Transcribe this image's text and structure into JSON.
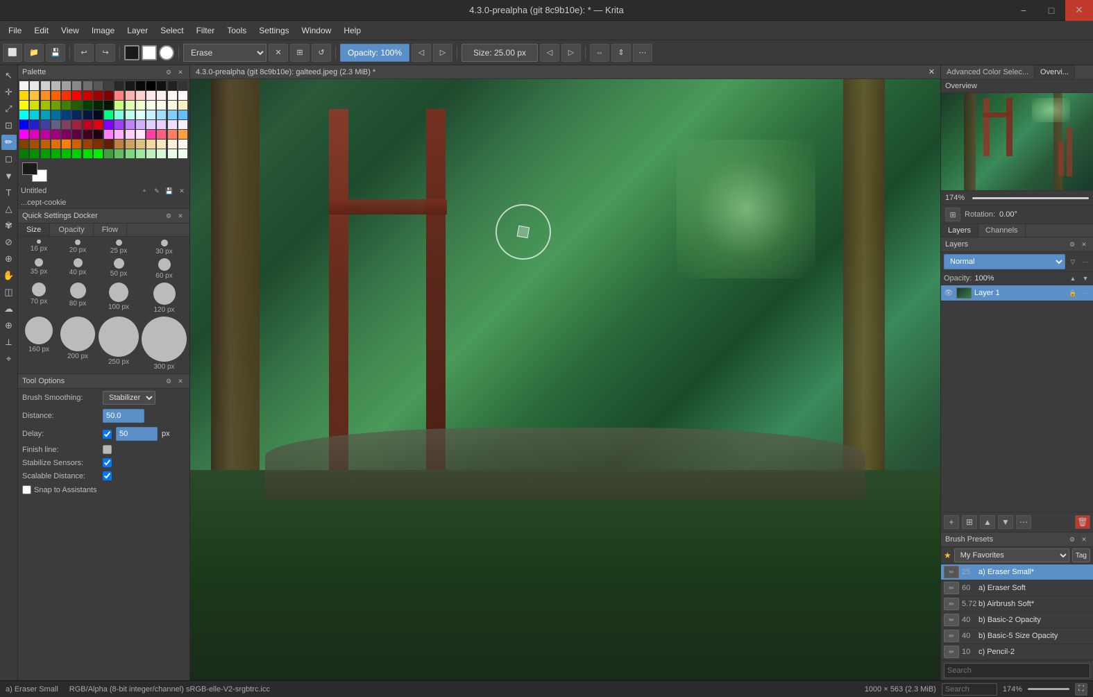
{
  "titlebar": {
    "title": "4.3.0-prealpha (git 8c9b10e): * — Krita",
    "min": "−",
    "max": "□",
    "close": "✕"
  },
  "menubar": {
    "items": [
      "File",
      "Edit",
      "View",
      "Image",
      "Layer",
      "Select",
      "Filter",
      "Tools",
      "Settings",
      "Window",
      "Help"
    ]
  },
  "toolbar": {
    "erase_label": "Erase",
    "opacity_label": "Opacity: 100%",
    "size_label": "Size: 25.00 px"
  },
  "canvas_tab": {
    "title": "4.3.0-prealpha (git 8c9b10e): galteed.jpeg (2.3 MiB) *"
  },
  "left_panel": {
    "palette": {
      "label": "Palette",
      "colors": [
        "#f5f5f5",
        "#e8e8e8",
        "#d0d0d0",
        "#b8b8b8",
        "#a0a0a0",
        "#888888",
        "#707070",
        "#585858",
        "#404040",
        "#282828",
        "#181818",
        "#080808",
        "#000000",
        "#111111",
        "#222222",
        "#333333",
        "#ffd700",
        "#ffc040",
        "#ff9020",
        "#ff6000",
        "#ff3000",
        "#ff0000",
        "#d00000",
        "#a00000",
        "#800000",
        "#ff8080",
        "#ffb0b0",
        "#ffd0d0",
        "#ffe8e8",
        "#fff0f0",
        "#fff5f5",
        "#fffafa",
        "#ffff00",
        "#d0e000",
        "#a0c000",
        "#70a000",
        "#408000",
        "#206000",
        "#004000",
        "#002800",
        "#001800",
        "#c8ff80",
        "#e0ffb0",
        "#f0ffd0",
        "#f8ffe8",
        "#fffdf0",
        "#fff8e0",
        "#fff0c0",
        "#00ffff",
        "#00d0e0",
        "#00a0c0",
        "#0070a0",
        "#004080",
        "#002860",
        "#001840",
        "#000820",
        "#00ff80",
        "#80ffe0",
        "#c0fff0",
        "#e0fff8",
        "#c8f0ff",
        "#a0e0ff",
        "#80d0ff",
        "#60c0ff",
        "#0000ff",
        "#2020d0",
        "#4040a0",
        "#606080",
        "#804060",
        "#a02040",
        "#c00020",
        "#e00010",
        "#8000ff",
        "#a040ff",
        "#c080ff",
        "#d0b0ff",
        "#e0d0ff",
        "#ead0ff",
        "#f0e0ff",
        "#f8f0ff",
        "#ff00ff",
        "#e000c0",
        "#c000a0",
        "#a00080",
        "#800060",
        "#600040",
        "#400020",
        "#200010",
        "#ff80ff",
        "#ffb0ff",
        "#ffd0ff",
        "#ffe8ff",
        "#ff40a0",
        "#ff6080",
        "#ff8060",
        "#ffa040",
        "#804000",
        "#a05000",
        "#c06000",
        "#e07000",
        "#ff8000",
        "#d06000",
        "#a04000",
        "#803000",
        "#602000",
        "#c08040",
        "#d0a060",
        "#e0c080",
        "#f0d8a0",
        "#f8e8c0",
        "#fff0d8",
        "#fff8f0",
        "#008000",
        "#009000",
        "#00a000",
        "#00b000",
        "#00c000",
        "#00d000",
        "#00e000",
        "#00f000",
        "#40a040",
        "#60c060",
        "#80d880",
        "#a0e8a0",
        "#c0f0c0",
        "#d8f8d8",
        "#e8fce8",
        "#f0fff0"
      ],
      "fg_color": "#1a1a1a",
      "bg_color": "#ffffff",
      "name_label": "Untitled",
      "sub_label": "...cept-cookie"
    },
    "quick_settings": {
      "label": "Quick Settings Docker",
      "tabs": [
        "Size",
        "Opacity",
        "Flow"
      ],
      "active_tab": "Size",
      "brush_sizes": [
        {
          "size": 6,
          "label": "16 px"
        },
        {
          "size": 8,
          "label": "20 px"
        },
        {
          "size": 9,
          "label": "25 px"
        },
        {
          "size": 10,
          "label": "30 px"
        },
        {
          "size": 12,
          "label": "35 px"
        },
        {
          "size": 13,
          "label": "40 px"
        },
        {
          "size": 15,
          "label": "50 px"
        },
        {
          "size": 18,
          "label": "60 px"
        },
        {
          "size": 20,
          "label": "70 px"
        },
        {
          "size": 23,
          "label": "80 px"
        },
        {
          "size": 28,
          "label": "100 px"
        },
        {
          "size": 32,
          "label": "120 px"
        },
        {
          "size": 40,
          "label": "160 px"
        },
        {
          "size": 50,
          "label": "200 px"
        },
        {
          "size": 58,
          "label": "250 px"
        },
        {
          "size": 65,
          "label": "300 px"
        }
      ]
    },
    "tool_options": {
      "label": "Tool Options",
      "brush_smoothing_label": "Brush Smoothing:",
      "brush_smoothing_value": "Stabilizer",
      "distance_label": "Distance:",
      "distance_value": "50.0",
      "delay_label": "Delay:",
      "delay_value": "50",
      "delay_unit": "px",
      "finish_line_label": "Finish line:",
      "stabilize_sensors_label": "Stabilize Sensors:",
      "scalable_distance_label": "Scalable Distance:",
      "snap_label": "Snap to Assistants"
    }
  },
  "right_panel": {
    "overview_tabs": [
      "Advanced Color Selec...",
      "Overvi..."
    ],
    "active_overview_tab": "Overvi...",
    "overview_label": "Overview",
    "zoom_pct": "174%",
    "rotation_label": "Rotation:",
    "rotation_value": "0.00°",
    "layer_tabs": [
      "Layers",
      "Channels"
    ],
    "active_layer_tab": "Layers",
    "layers_header": "Layers",
    "blend_mode": "Normal",
    "opacity_label": "Opacity:",
    "opacity_value": "100%",
    "layers": [
      {
        "name": "Layer 1",
        "visible": true
      }
    ],
    "brush_presets_label": "Brush Presets",
    "favorites_label": "My Favorites",
    "tag_label": "Tag",
    "brushes": [
      {
        "num": "25",
        "name": "a) Eraser Small*",
        "active": true
      },
      {
        "num": "60",
        "name": "a) Eraser Soft",
        "active": false
      },
      {
        "num": "5.72",
        "name": "b) Airbrush Soft*",
        "active": false
      },
      {
        "num": "40",
        "name": "b) Basic-2 Opacity",
        "active": false
      },
      {
        "num": "40",
        "name": "b) Basic-5 Size Opacity",
        "active": false
      },
      {
        "num": "10",
        "name": "c) Pencil-2",
        "active": false
      }
    ],
    "search_placeholder": "Search",
    "zoom_right": "174%"
  }
}
